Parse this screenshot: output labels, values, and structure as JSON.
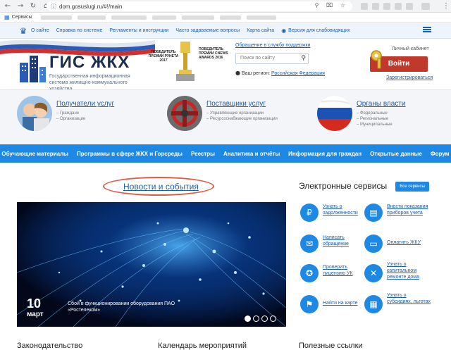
{
  "browser": {
    "url": "dom.gosuslugi.ru/#!/main",
    "bookmark_apps_label": "Сервисы"
  },
  "top_links": [
    "О сайте",
    "Справка по системе",
    "Регламенты и инструкции",
    "Часто задаваемые вопросы",
    "Карта сайта"
  ],
  "accessibility_link": "Версия для слабовидящих",
  "header": {
    "logo_title": "ГИС ЖКХ",
    "logo_subtitle": "Государственная информационная система жилищно-коммунального хозяйства",
    "award_1": "ПОБЕДИТЕЛЬ ПРЕМИИ РУНЕТА 2017",
    "award_2": "ПОБЕДИТЕЛЬ ПРЕМИИ CNEWS AWARDS 2016",
    "support_link": "Обращение в службу поддержки",
    "search_placeholder": "Поиск по сайту",
    "region_label": "Ваш регион:",
    "region_value": "Российская Федерация",
    "cabinet_label": "Личный кабинет",
    "login_label": "Войти",
    "register_label": "Зарегистрироваться"
  },
  "categories": [
    {
      "title": "Получатели услуг",
      "lines": [
        "– Граждане",
        "– Организации"
      ]
    },
    {
      "title": "Поставщики услуг",
      "lines": [
        "– Управляющие организации",
        "– Ресурсоснабжающие организации"
      ]
    },
    {
      "title": "Органы власти",
      "lines": [
        "– Федеральные",
        "– Региональные",
        "– Муниципальные"
      ]
    }
  ],
  "main_nav": [
    "Обучающие материалы",
    "Программы в сфере ЖКХ и Горсреды",
    "Реестры",
    "Аналитика и отчёты",
    "Информация для граждан",
    "Открытые данные",
    "Форум"
  ],
  "news": {
    "heading": "Новости и события",
    "day": "10",
    "month": "март",
    "text": "Сбой в функционировании оборудования ПАО «Ростелеком»"
  },
  "services": {
    "title": "Электронные сервисы",
    "all_label": "Все сервисы",
    "items": [
      {
        "label": "Узнать о задолженности",
        "icon": "ruble-icon"
      },
      {
        "label": "Внести показания приборов учета",
        "icon": "meter-icon"
      },
      {
        "label": "Написать обращение",
        "icon": "chat-icon"
      },
      {
        "label": "Оплатить ЖКУ",
        "icon": "card-icon"
      },
      {
        "label": "Проверить лицензию УК",
        "icon": "medal-icon"
      },
      {
        "label": "Узнать о капитальном ремонте дома",
        "icon": "tools-icon"
      },
      {
        "label": "Найти на карте",
        "icon": "pin-icon"
      },
      {
        "label": "Узнать о субсидиях, льготах",
        "icon": "calculator-icon"
      }
    ]
  },
  "bottom_headings": [
    "Законодательство",
    "Календарь мероприятий",
    "Полезные ссылки"
  ],
  "colors": {
    "accent": "#1e88e5",
    "login": "#c0392b",
    "highlight": "#e35a48"
  }
}
